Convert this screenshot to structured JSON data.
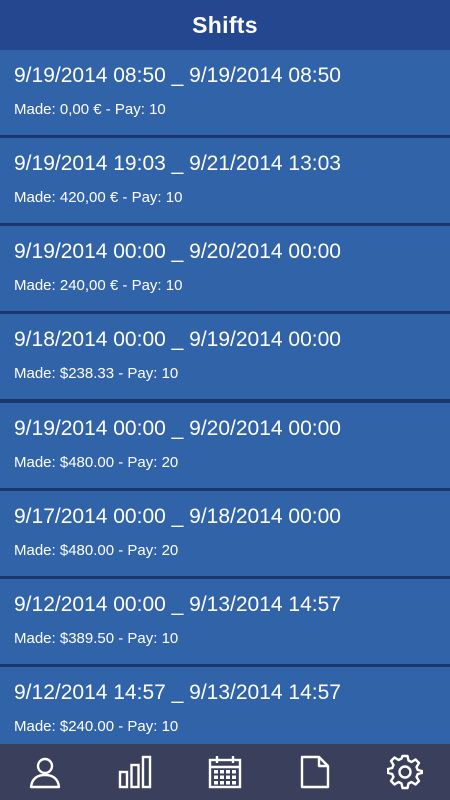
{
  "header": {
    "title": "Shifts"
  },
  "shifts": [
    {
      "range": "9/19/2014 08:50 _ 9/19/2014 08:50",
      "meta": "Made: 0,00 € - Pay: 10"
    },
    {
      "range": "9/19/2014 19:03 _ 9/21/2014 13:03",
      "meta": "Made: 420,00 € - Pay: 10"
    },
    {
      "range": "9/19/2014 00:00 _ 9/20/2014 00:00",
      "meta": "Made: 240,00 € - Pay: 10"
    },
    {
      "range": "9/18/2014 00:00 _ 9/19/2014 00:00",
      "meta": "Made: $238.33 - Pay: 10"
    },
    {
      "range": "9/19/2014 00:00 _ 9/20/2014 00:00",
      "meta": "Made: $480.00 - Pay: 20"
    },
    {
      "range": "9/17/2014 00:00 _ 9/18/2014 00:00",
      "meta": "Made: $480.00 - Pay: 20"
    },
    {
      "range": "9/12/2014 00:00 _ 9/13/2014 14:57",
      "meta": "Made: $389.50 - Pay: 10"
    },
    {
      "range": "9/12/2014 14:57 _ 9/13/2014 14:57",
      "meta": "Made: $240.00 - Pay: 10"
    }
  ],
  "tabbar": {
    "tabs": [
      {
        "icon": "person-icon"
      },
      {
        "icon": "bar-chart-icon"
      },
      {
        "icon": "calendar-icon"
      },
      {
        "icon": "document-icon"
      },
      {
        "icon": "gear-icon"
      }
    ]
  },
  "colors": {
    "header": "#24478f",
    "row": "#3163a8",
    "separator": "#1c376e",
    "tabbar": "#3a3f5c",
    "text": "#ffffff"
  }
}
